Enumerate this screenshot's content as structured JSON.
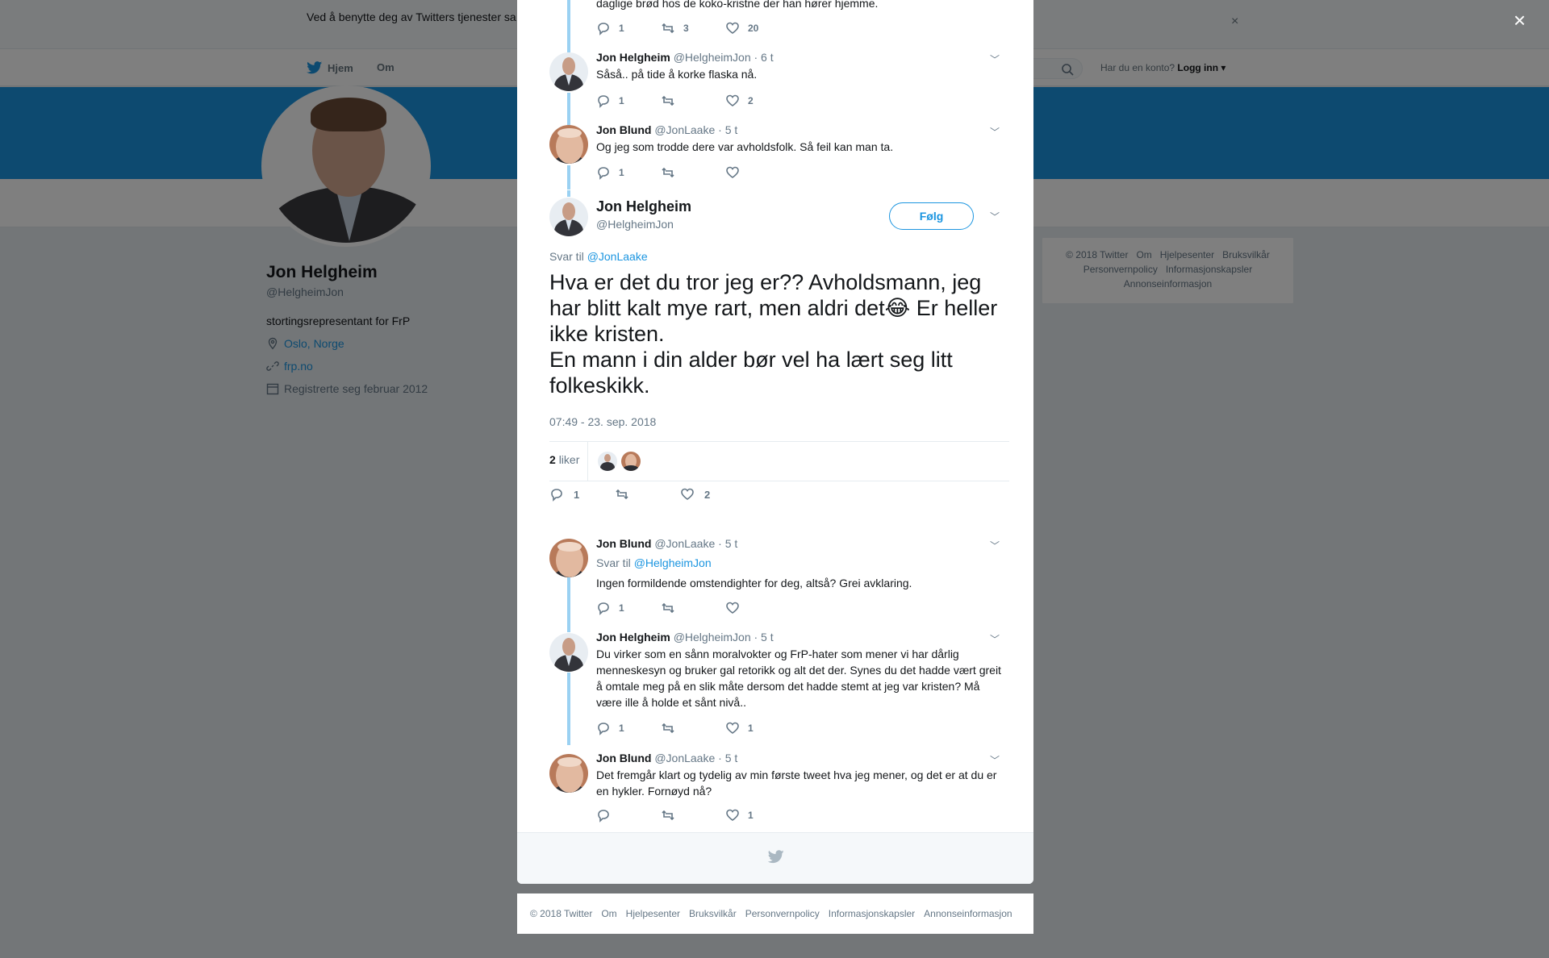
{
  "cookie_banner": {
    "text": "Ved å benytte deg av Twitters tjenester sa                                                                                                                informasjonskapsler til bl.a. analyser, personalisering og annonser.",
    "close": "×"
  },
  "topnav": {
    "home": "Hjem",
    "about": "Om",
    "login_prompt": "Har du en konto?",
    "login": "Logg inn"
  },
  "profile": {
    "name": "Jon Helgheim",
    "handle": "@HelgheimJon",
    "bio": "stortingsrepresentant for FrP",
    "location": "Oslo, Norge",
    "website": "frp.no",
    "joined": "Registrerte seg februar 2012"
  },
  "side_footer": [
    "© 2018 Twitter",
    "Om",
    "Hjelpesenter",
    "Bruksvilkår",
    "Personvernpolicy",
    "Informasjonskapsler",
    "Annonseinformasjon"
  ],
  "overlay_close": "×",
  "tweets_above": [
    {
      "body": "daglige brød hos de koko-kristne der han hører hjemme.",
      "replies": "1",
      "retweets": "3",
      "likes": "20"
    },
    {
      "name": "Jon Helgheim",
      "handle": "@HelgheimJon",
      "time": "· 6 t",
      "body": "Såså.. på tide å korke flaska nå.",
      "replies": "1",
      "retweets": "",
      "likes": "2"
    },
    {
      "name": "Jon Blund",
      "handle": "@JonLaake",
      "time": "· 5 t",
      "body": "Og jeg som trodde dere var avholdsfolk. Så feil kan man ta.",
      "replies": "1",
      "retweets": "",
      "likes": ""
    }
  ],
  "main_tweet": {
    "name": "Jon Helgheim",
    "handle": "@HelgheimJon",
    "follow": "Følg",
    "reply_prefix": "Svar til",
    "reply_to": "@JonLaake",
    "text_part1": "Hva er det du tror jeg er?? Avholdsmann, jeg har blitt kalt mye rart, men aldri det",
    "emoji": "😂",
    "text_part2": " Er heller ikke kristen.\nEn mann i din alder bør vel ha lært seg litt folkeskikk.",
    "timestamp": "07:49 - 23. sep. 2018",
    "likes_count": "2",
    "likes_label": "liker",
    "replies": "1",
    "retweets": "",
    "likes": "2"
  },
  "replies": [
    {
      "name": "Jon Blund",
      "handle": "@JonLaake",
      "time": "· 5 t",
      "reply_prefix": "Svar til",
      "reply_to": "@HelgheimJon",
      "body": "Ingen formildende omstendighter for deg, altså? Grei avklaring.",
      "replies": "1",
      "retweets": "",
      "likes": ""
    },
    {
      "name": "Jon Helgheim",
      "handle": "@HelgheimJon",
      "time": "· 5 t",
      "body": "Du virker som en sånn moralvokter og FrP-hater som mener vi har dårlig menneskesyn og bruker gal retorikk og alt det der. Synes du det hadde vært greit å omtale meg på en slik måte dersom det hadde stemt at jeg var kristen? Må være ille å holde et sånt nivå..",
      "replies": "1",
      "retweets": "",
      "likes": "1"
    },
    {
      "name": "Jon Blund",
      "handle": "@JonLaake",
      "time": "· 5 t",
      "body": "Det fremgår klart og tydelig av min første tweet hva jeg mener, og det er at du er en hykler. Fornøyd nå?",
      "replies": "",
      "retweets": "",
      "likes": "1"
    }
  ],
  "bottom_footer": [
    "© 2018 Twitter",
    "Om",
    "Hjelpesenter",
    "Bruksvilkår",
    "Personvernpolicy",
    "Informasjonskapsler",
    "Annonseinformasjon"
  ],
  "colors": {
    "accent": "#1b95e0",
    "thread_line": "#9ad1f2",
    "overlay": "rgba(0,0,0,0.5)"
  }
}
